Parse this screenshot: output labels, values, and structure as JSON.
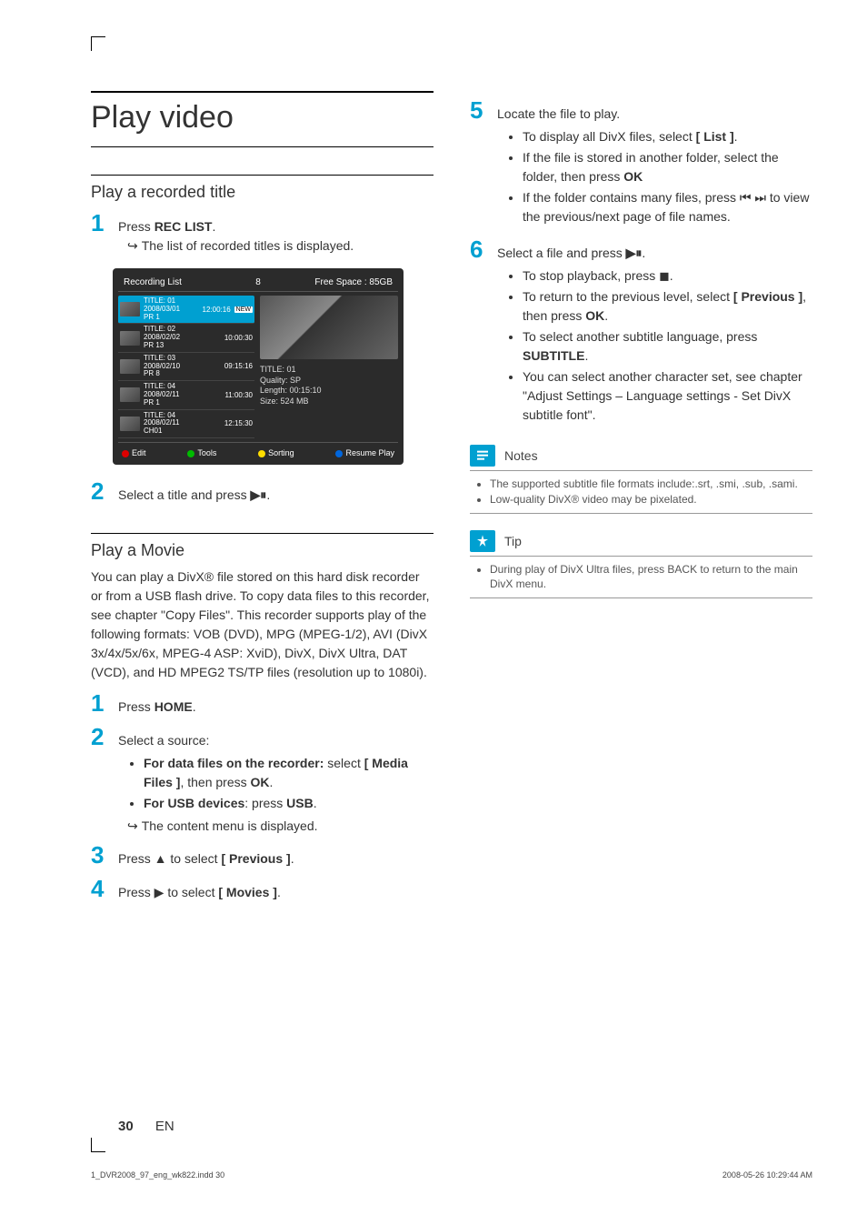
{
  "title": "Play video",
  "section_recorded_title": "Play a recorded title",
  "step1_text_prefix": "Press ",
  "step1_text_bold": "REC LIST",
  "step1_text_suffix": ".",
  "step1_sub": "The list of recorded titles is displayed.",
  "ui": {
    "header_left": "Recording List",
    "header_mid": "8",
    "header_right": "Free Space : 85GB",
    "rows": [
      {
        "title": "TITLE: 01",
        "date": "2008/03/01",
        "src": "PR 1",
        "time": "12:00:16",
        "new": true
      },
      {
        "title": "TITLE: 02",
        "date": "2008/02/02",
        "src": "PR 13",
        "time": "10:00:30",
        "new": false
      },
      {
        "title": "TITLE: 03",
        "date": "2008/02/10",
        "src": "PR 8",
        "time": "09:15:16",
        "new": false
      },
      {
        "title": "TITLE: 04",
        "date": "2008/02/11",
        "src": "PR 1",
        "time": "11:00:30",
        "new": false
      },
      {
        "title": "TITLE: 04",
        "date": "2008/02/11",
        "src": "CH01",
        "time": "12:15:30",
        "new": false
      }
    ],
    "info": {
      "l1": "TITLE: 01",
      "l2": "Quality: SP",
      "l3": "Length: 00:15:10",
      "l4": "Size: 524 MB"
    },
    "footer": {
      "edit": "Edit",
      "tools": "Tools",
      "sorting": "Sorting",
      "resume": "Resume Play"
    }
  },
  "step2_text": "Select a title and press ",
  "section_movie": "Play a Movie",
  "movie_para": "You can play a DivX® file stored on this hard disk recorder or from a USB flash drive. To copy data files to this recorder, see chapter \"Copy Files\". This recorder supports play of the following formats: VOB (DVD), MPG (MPEG-1/2), AVI (DivX 3x/4x/5x/6x, MPEG-4 ASP: XviD), DivX, DivX Ultra, DAT (VCD), and HD MPEG2 TS/TP files (resolution up to 1080i).",
  "m_step1_prefix": "Press ",
  "m_step1_bold": "HOME",
  "m_step1_suffix": ".",
  "m_step2": "Select a source:",
  "m_step2_b1_prefix": "For data files on the recorder: ",
  "m_step2_b1_mid": "select ",
  "m_step2_b1_bold": "[ Media Files ]",
  "m_step2_b1_suffix1": ", then press ",
  "m_step2_b1_bold2": "OK",
  "m_step2_b1_suffix2": ".",
  "m_step2_b2_prefix": "For USB devices",
  "m_step2_b2_suffix": ": press ",
  "m_step2_b2_bold": "USB",
  "m_step2_b2_suffix2": ".",
  "m_step2_sub": "The content menu is displayed.",
  "m_step3_prefix": "Press ▲ to select ",
  "m_step3_bold": "[ Previous ]",
  "m_step3_suffix": ".",
  "m_step4_prefix": "Press ▶ to select ",
  "m_step4_bold": "[ Movies ]",
  "m_step4_suffix": ".",
  "r_step5": "Locate the file to play.",
  "r_step5_b1_prefix": "To display all DivX files, select ",
  "r_step5_b1_bold": "[ List ]",
  "r_step5_b1_suffix": ".",
  "r_step5_b2_prefix": "If the file is stored in another folder, select the folder, then press ",
  "r_step5_b2_bold": "OK",
  "r_step5_b3": "If the folder contains many files, press ⏮ ⏭ to view the previous/next page of file names.",
  "r_step6_prefix": "Select a file and press ",
  "r_step6_b1": "To stop playback, press ◼.",
  "r_step6_b2_prefix": "To return to the previous level, select ",
  "r_step6_b2_bold": "[ Previous ]",
  "r_step6_b2_mid": ", then press ",
  "r_step6_b2_bold2": "OK",
  "r_step6_b2_suffix": ".",
  "r_step6_b3_prefix": "To select another subtitle language, press ",
  "r_step6_b3_bold": "SUBTITLE",
  "r_step6_b3_suffix": ".",
  "r_step6_b4": "You can select another character set, see chapter \"Adjust Settings – Language settings - Set DivX subtitle font\".",
  "notes_title": "Notes",
  "notes_b1": "The supported subtitle file formats include:.srt, .smi, .sub, .sami.",
  "notes_b2": "Low-quality DivX® video may be pixelated.",
  "tip_title": "Tip",
  "tip_b1": "During play of DivX Ultra files, press BACK to return to the main DivX menu.",
  "page_num": "30",
  "page_lang": "EN",
  "indd": "1_DVR2008_97_eng_wk822.indd   30",
  "timestamp": "2008-05-26   10:29:44 AM"
}
